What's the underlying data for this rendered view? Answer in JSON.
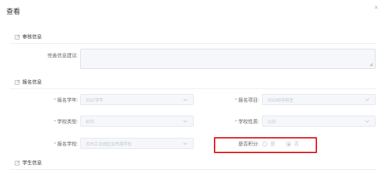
{
  "dialog": {
    "title": "查看",
    "close_symbol": "×"
  },
  "sections": {
    "review": "审核信息",
    "registration": "报名信息",
    "student": "学生信息"
  },
  "review": {
    "suggestion_label": "完善信息建议:",
    "suggestion_value": ""
  },
  "fields": {
    "school_year_label": "报名学年:",
    "school_year_value": "2022学年",
    "project_label": "报名项目:",
    "project_value": "2022初中招生",
    "school_type_label": "学校类型:",
    "school_type_value": "初中",
    "school_nature_label": "学校性质:",
    "school_nature_value": "公办",
    "school_label": "报名学校:",
    "school_value": "苏州工业园区金鸡湖学校",
    "points_label": "是否积分:",
    "points_options": [
      "是",
      "否"
    ],
    "points_selected": "否"
  },
  "required_marker": "*",
  "colors": {
    "highlight": "#e02020",
    "required": "#f56c6c"
  }
}
